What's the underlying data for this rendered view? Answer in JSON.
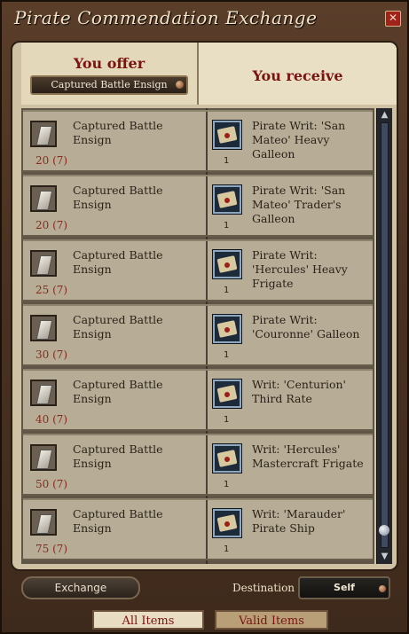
{
  "window": {
    "title": "Pirate Commendation Exchange"
  },
  "header": {
    "offer_label": "You offer",
    "offer_selected": "Captured Battle Ensign",
    "receive_label": "You receive"
  },
  "rows": [
    {
      "offer_name": "Captured Battle Ensign",
      "offer_qty": "20 (7)",
      "receive_name": "Pirate Writ: 'San Mateo' Heavy Galleon",
      "receive_qty": "1"
    },
    {
      "offer_name": "Captured Battle Ensign",
      "offer_qty": "20 (7)",
      "receive_name": "Pirate Writ: 'San Mateo' Trader's Galleon",
      "receive_qty": "1"
    },
    {
      "offer_name": "Captured Battle Ensign",
      "offer_qty": "25 (7)",
      "receive_name": "Pirate Writ: 'Hercules' Heavy Frigate",
      "receive_qty": "1"
    },
    {
      "offer_name": "Captured Battle Ensign",
      "offer_qty": "30 (7)",
      "receive_name": "Pirate Writ: 'Couronne' Galleon",
      "receive_qty": "1"
    },
    {
      "offer_name": "Captured Battle Ensign",
      "offer_qty": "40 (7)",
      "receive_name": "Writ: 'Centurion' Third Rate",
      "receive_qty": "1"
    },
    {
      "offer_name": "Captured Battle Ensign",
      "offer_qty": "50 (7)",
      "receive_name": "Writ: 'Hercules' Mastercraft Frigate",
      "receive_qty": "1"
    },
    {
      "offer_name": "Captured Battle Ensign",
      "offer_qty": "75 (7)",
      "receive_name": "Writ: 'Marauder' Pirate Ship",
      "receive_qty": "1"
    }
  ],
  "footer": {
    "exchange_label": "Exchange",
    "destination_label": "Destination",
    "destination_value": "Self"
  },
  "tabs": [
    {
      "label": "All Items",
      "active": true
    },
    {
      "label": "Valid Items",
      "active": false
    }
  ],
  "icons": {
    "close": "close-icon",
    "offer_item": "ensign-icon",
    "receive_item": "writ-scroll-icon"
  }
}
